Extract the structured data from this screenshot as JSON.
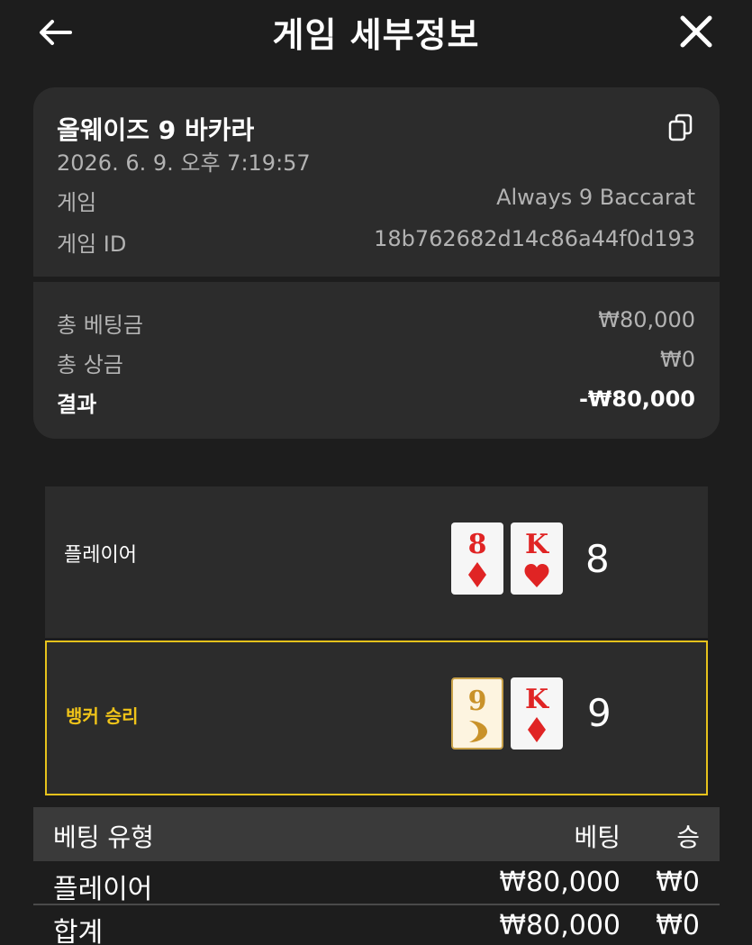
{
  "header": {
    "title": "게임 세부정보",
    "back_icon": "arrow-left-icon",
    "close_icon": "close-icon"
  },
  "summary": {
    "game_name": "올웨이즈 9 바카라",
    "datetime": "2026. 6. 9. 오후 7:19:57",
    "copy_icon": "copy-icon",
    "rows": [
      {
        "label": "게임",
        "value": "Always 9 Baccarat"
      },
      {
        "label": "게임 ID",
        "value": "18b762682d14c86a44f0d193"
      }
    ],
    "totals": [
      {
        "label": "총 베팅금",
        "value": "₩80,000"
      },
      {
        "label": "총 상금",
        "value": "₩0"
      },
      {
        "label": "결과",
        "value": "-₩80,000"
      }
    ]
  },
  "hands": {
    "player": {
      "label": "플레이어",
      "score": "8",
      "cards": [
        {
          "rank": "8",
          "suit": "diamond"
        },
        {
          "rank": "K",
          "suit": "heart"
        }
      ]
    },
    "banker": {
      "label": "뱅커 승리",
      "score": "9",
      "cards": [
        {
          "rank": "9",
          "suit": "always9-special"
        },
        {
          "rank": "K",
          "suit": "diamond"
        }
      ]
    }
  },
  "colors": {
    "background": "#1d1d1d",
    "card_bg": "#2c2c2c",
    "winner_accent": "#e6c21c",
    "suit_red": "#e02424"
  },
  "bets_table": {
    "headers": [
      "베팅 유형",
      "베팅",
      "승"
    ],
    "rows": [
      [
        "플레이어",
        "₩80,000",
        "₩0"
      ],
      [
        "합계",
        "₩80,000",
        "₩0"
      ]
    ]
  }
}
